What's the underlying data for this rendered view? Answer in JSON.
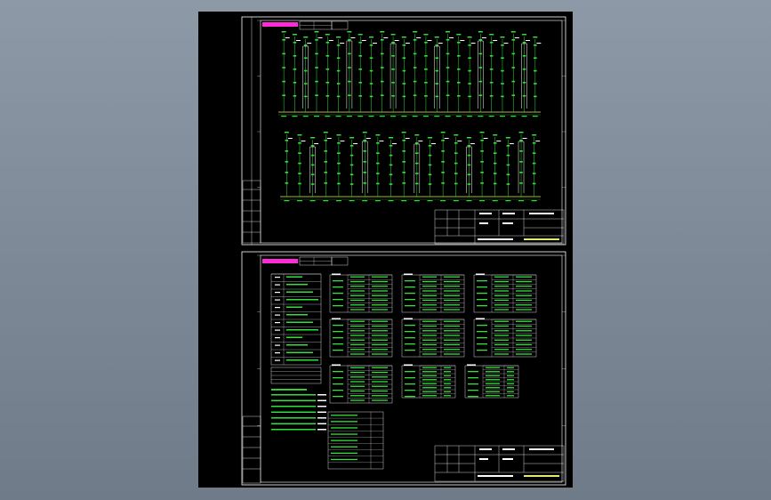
{
  "colors": {
    "background": "#7f8c99",
    "sheet": "#000000",
    "frame": "#ffffff",
    "wire": "#31e13a",
    "bus": "#e8e86a",
    "tag": "#ff2bd6",
    "text": "#ffffff"
  },
  "top_drawing": {
    "header": {
      "tag_label": "",
      "field1": "",
      "field2": "",
      "field3": ""
    },
    "row1_feeders": 24,
    "row2_feeders": 20
  },
  "bottom_drawing": {
    "header": {
      "tag_label": "",
      "field1": "",
      "field2": "",
      "field3": ""
    },
    "tables": 9,
    "legend_rows": 12
  }
}
